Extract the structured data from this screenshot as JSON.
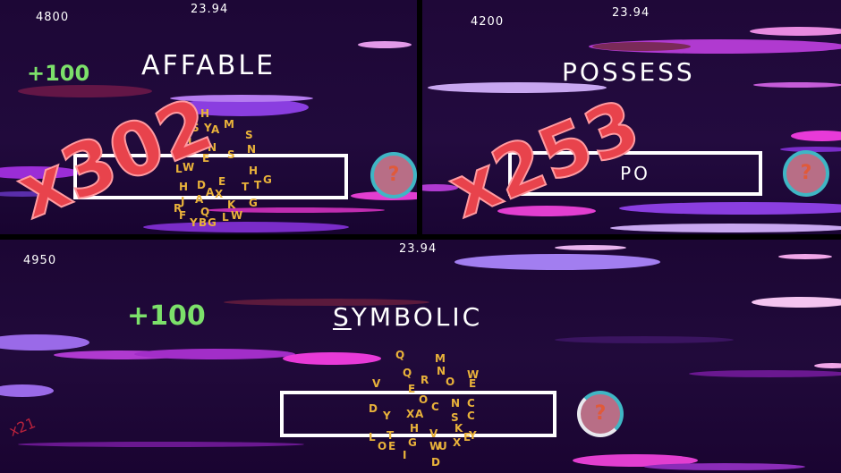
{
  "top_left": {
    "score": "4800",
    "timer": "23.94",
    "bonus": "+100",
    "word": "AFFABLE",
    "answer": "",
    "hint_icon": "?",
    "combo": "x302",
    "letters": [
      "H",
      "S",
      "Y",
      "A",
      "M",
      "S",
      "N",
      "L",
      "W",
      "E",
      "S",
      "H",
      "G",
      "T",
      "J",
      "R",
      "A",
      "K",
      "G",
      "Y",
      "B",
      "G",
      "L",
      "W",
      "E",
      "A",
      "X",
      "Q",
      "F",
      "H",
      "D",
      "N",
      "L",
      "T"
    ]
  },
  "top_right": {
    "score": "4200",
    "timer": "23.94",
    "word": "POSSESS",
    "answer": "PO",
    "hint_icon": "?",
    "combo": "x253"
  },
  "bottom": {
    "score": "4950",
    "timer": "23.94",
    "bonus": "+100",
    "word_first": "S",
    "word_rest": "YMBOLIC",
    "answer": "",
    "hint_icon": "?",
    "small_combo": "x21",
    "letters": [
      "Q",
      "M",
      "N",
      "W",
      "E",
      "O",
      "R",
      "Q",
      "V",
      "E",
      "O",
      "C",
      "N",
      "C",
      "D",
      "Y",
      "X",
      "A",
      "C",
      "S",
      "K",
      "L",
      "H",
      "V",
      "X",
      "T",
      "E",
      "Y",
      "W",
      "E",
      "U",
      "G",
      "O",
      "I",
      "D"
    ]
  },
  "colors": {
    "accent_green": "#7ce06a",
    "combo_red": "#e8434c",
    "letter_gold": "#e9b23a",
    "hint_pink": "#b86e86",
    "hint_ring": "#3fb6c4"
  }
}
